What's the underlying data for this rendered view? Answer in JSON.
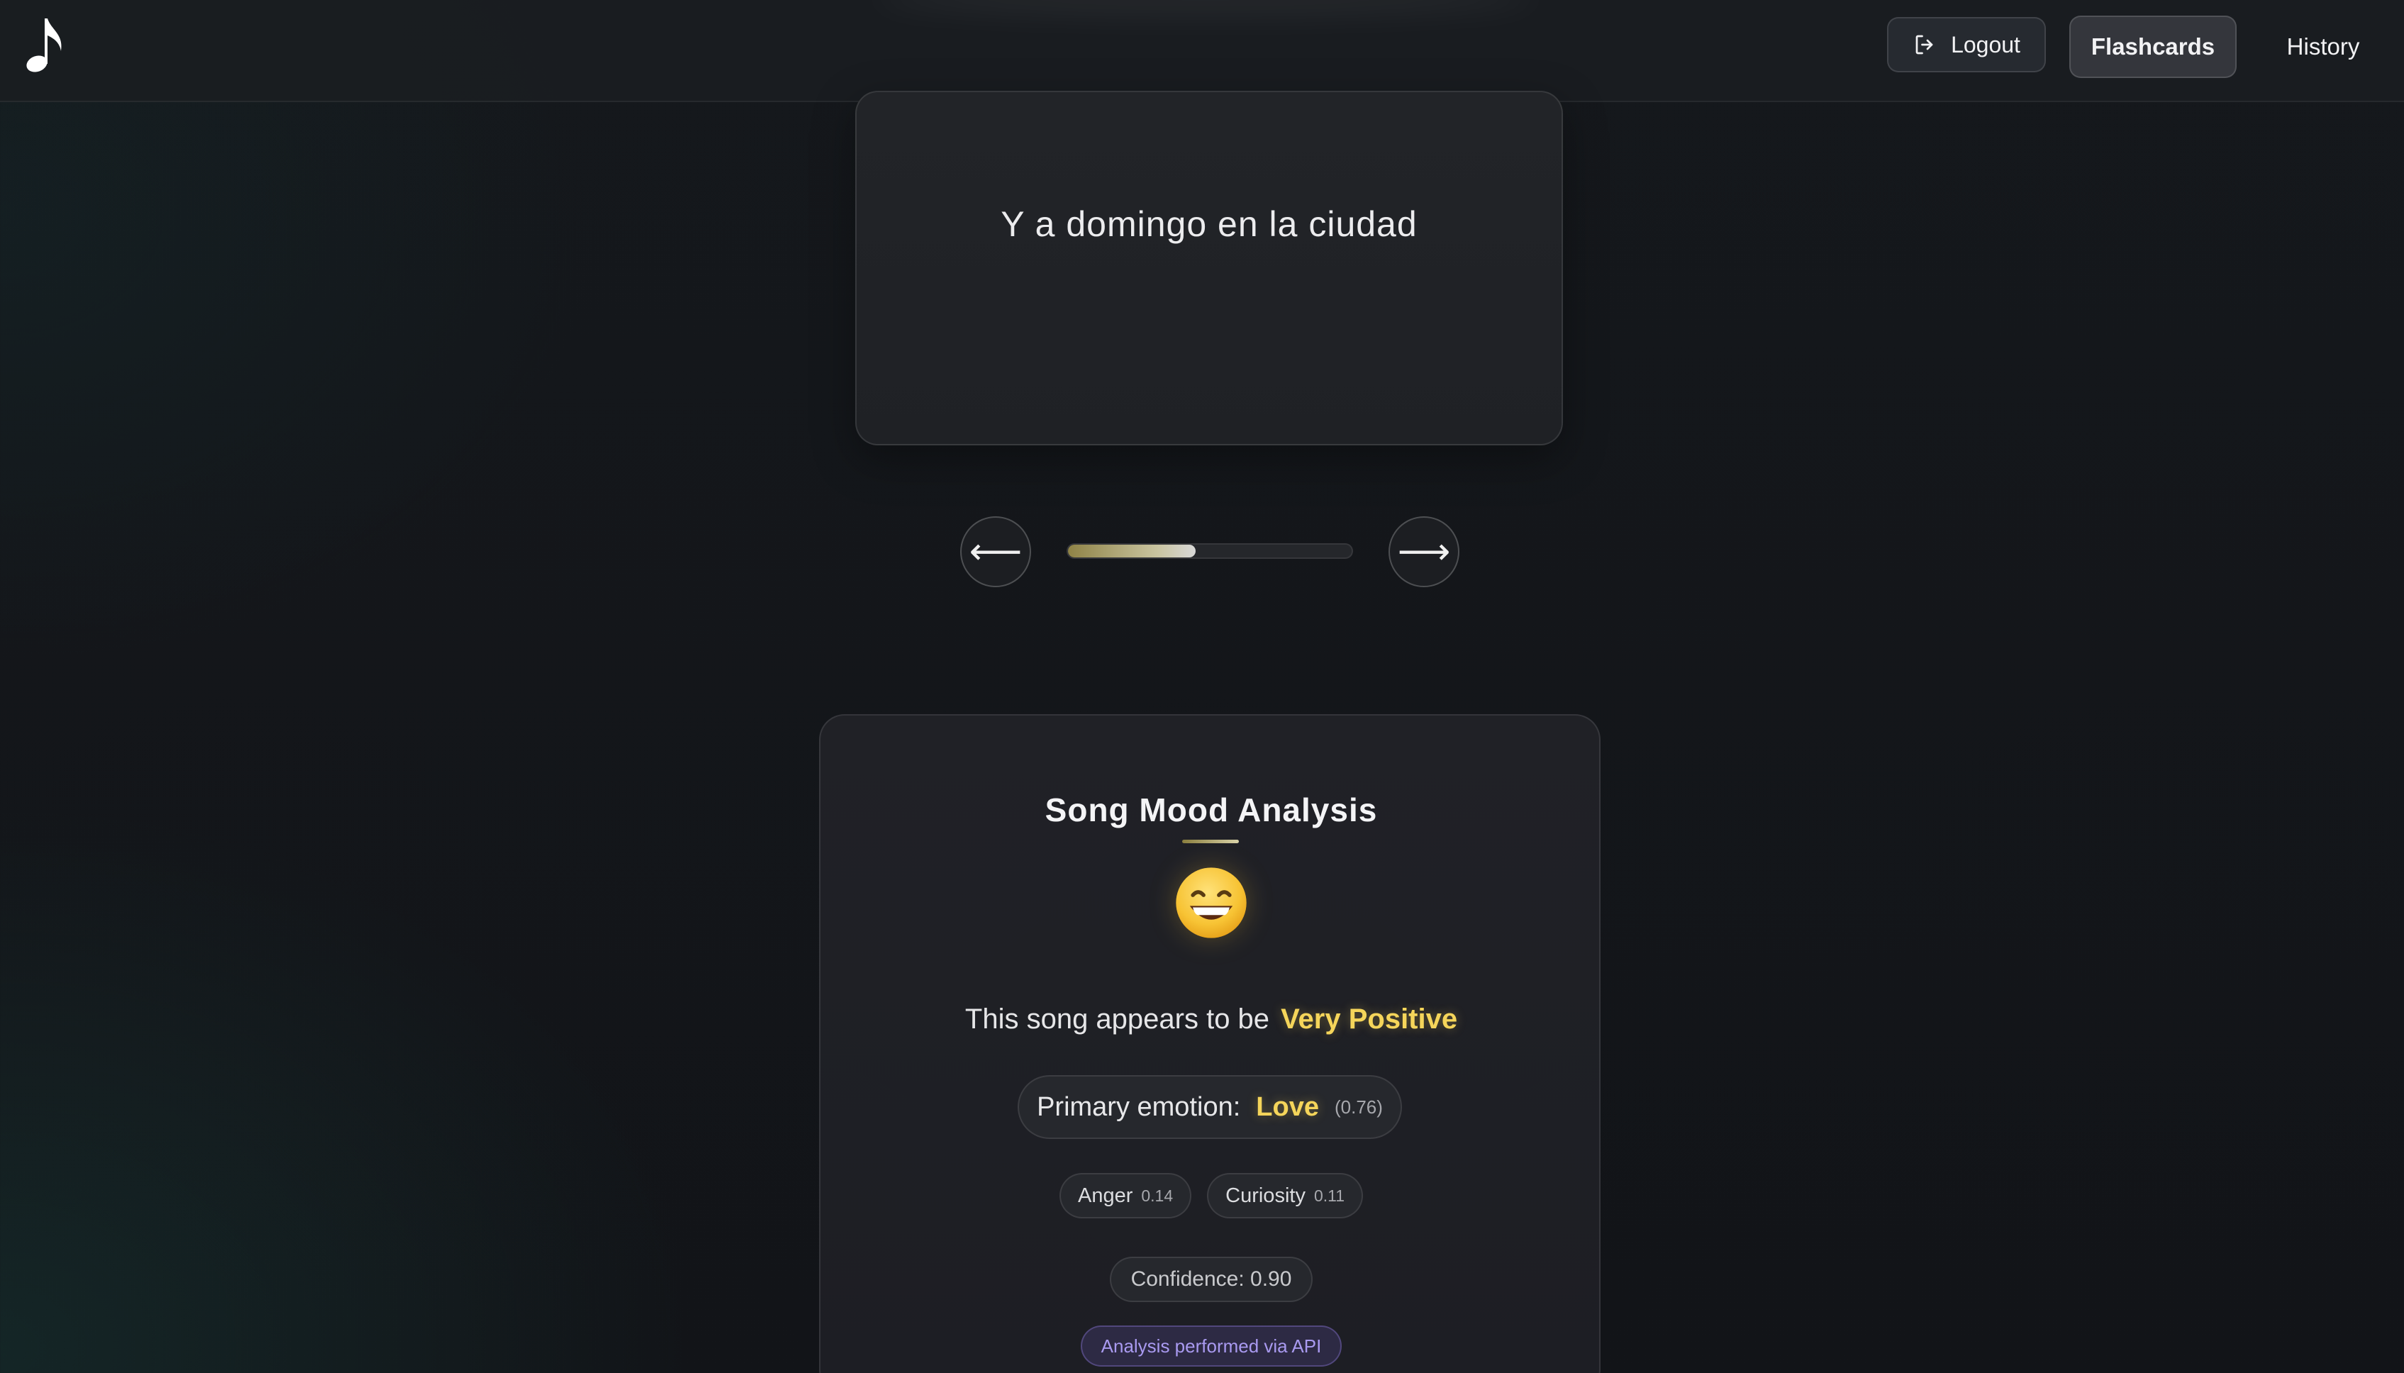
{
  "header": {
    "logo_icon": "music-note-icon",
    "logout_label": "Logout",
    "logout_icon": "logout-icon",
    "flashcards_label": "Flashcards",
    "history_label": "History"
  },
  "flashcard": {
    "text": "Y a domingo en la ciudad"
  },
  "pager": {
    "prev_icon": "arrow-left-icon",
    "prev_glyph": "⟵",
    "next_icon": "arrow-right-icon",
    "next_glyph": "⟶",
    "progress_fraction": 0.45
  },
  "mood": {
    "title": "Song Mood Analysis",
    "emoji_icon": "grinning-face-icon",
    "sentiment_prefix": "This song appears to be",
    "sentiment_value": "Very Positive",
    "primary_label": "Primary emotion:",
    "primary_emotion": "Love",
    "primary_score": "(0.76)",
    "secondary": [
      {
        "name": "Anger",
        "score": "0.14"
      },
      {
        "name": "Curiosity",
        "score": "0.11"
      }
    ],
    "confidence": "Confidence: 0.90",
    "source_badge": "Analysis performed via API"
  },
  "colors": {
    "accent_gold": "#f5d55a",
    "badge_purple": "#a99af0",
    "background": "#121418"
  }
}
